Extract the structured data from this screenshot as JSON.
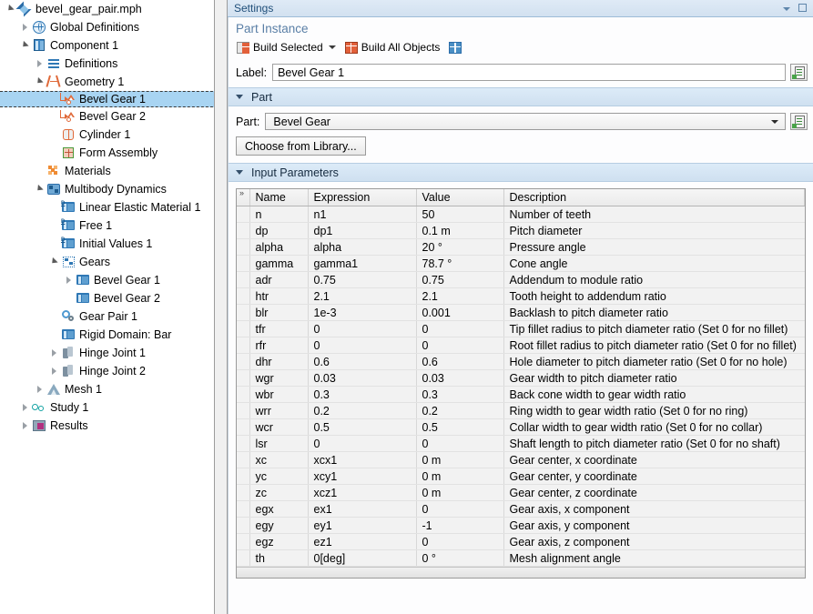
{
  "tree": {
    "items": [
      {
        "label": "bevel_gear_pair.mph",
        "indent": 0,
        "twisty": "open",
        "icon": "mph-file-icon",
        "selected": false
      },
      {
        "label": "Global Definitions",
        "indent": 1,
        "twisty": "closed",
        "icon": "globe-icon",
        "selected": false
      },
      {
        "label": "Component 1",
        "indent": 1,
        "twisty": "open",
        "icon": "component-icon",
        "selected": false
      },
      {
        "label": "Definitions",
        "indent": 2,
        "twisty": "closed",
        "icon": "definitions-icon",
        "selected": false
      },
      {
        "label": "Geometry 1",
        "indent": 2,
        "twisty": "open",
        "icon": "geometry-icon",
        "selected": false
      },
      {
        "label": "Bevel Gear 1",
        "indent": 3,
        "twisty": "none",
        "icon": "bevel-gear-geom-icon",
        "selected": true
      },
      {
        "label": "Bevel Gear 2",
        "indent": 3,
        "twisty": "none",
        "icon": "bevel-gear-geom-icon",
        "selected": false
      },
      {
        "label": "Cylinder 1",
        "indent": 3,
        "twisty": "none",
        "icon": "cylinder-icon",
        "selected": false
      },
      {
        "label": "Form Assembly",
        "indent": 3,
        "twisty": "none",
        "icon": "form-assembly-icon",
        "selected": false
      },
      {
        "label": "Materials",
        "indent": 2,
        "twisty": "none",
        "icon": "materials-icon",
        "selected": false
      },
      {
        "label": "Multibody Dynamics",
        "indent": 2,
        "twisty": "open",
        "icon": "multibody-dynamics-icon",
        "selected": false
      },
      {
        "label": "Linear Elastic Material 1",
        "indent": 3,
        "twisty": "none",
        "icon": "domain-icon",
        "selected": false
      },
      {
        "label": "Free 1",
        "indent": 3,
        "twisty": "none",
        "icon": "domain-icon",
        "selected": false
      },
      {
        "label": "Initial Values 1",
        "indent": 3,
        "twisty": "none",
        "icon": "domain-icon",
        "selected": false
      },
      {
        "label": "Gears",
        "indent": 3,
        "twisty": "open",
        "icon": "gears-icon",
        "selected": false
      },
      {
        "label": "Bevel Gear 1",
        "indent": 4,
        "twisty": "closed",
        "icon": "gear-node-icon",
        "selected": false
      },
      {
        "label": "Bevel Gear 2",
        "indent": 4,
        "twisty": "none",
        "icon": "gear-node-icon",
        "selected": false
      },
      {
        "label": "Gear Pair 1",
        "indent": 3,
        "twisty": "none",
        "icon": "gear-pair-icon",
        "selected": false
      },
      {
        "label": "Rigid Domain: Bar",
        "indent": 3,
        "twisty": "none",
        "icon": "gear-node-icon",
        "selected": false
      },
      {
        "label": "Hinge Joint 1",
        "indent": 3,
        "twisty": "closed",
        "icon": "hinge-joint-icon",
        "selected": false
      },
      {
        "label": "Hinge Joint 2",
        "indent": 3,
        "twisty": "closed",
        "icon": "hinge-joint-icon",
        "selected": false
      },
      {
        "label": "Mesh 1",
        "indent": 2,
        "twisty": "closed",
        "icon": "mesh-icon",
        "selected": false
      },
      {
        "label": "Study 1",
        "indent": 1,
        "twisty": "closed",
        "icon": "study-icon",
        "selected": false
      },
      {
        "label": "Results",
        "indent": 1,
        "twisty": "closed",
        "icon": "results-icon",
        "selected": false
      }
    ]
  },
  "settings": {
    "title": "Settings",
    "node_type": "Part Instance",
    "toolbar": {
      "build_selected": "Build Selected",
      "build_all_objects": "Build All Objects"
    },
    "label_field": {
      "label": "Label:",
      "value": "Bevel Gear 1"
    },
    "part_section": {
      "title": "Part",
      "part_label": "Part:",
      "part_value": "Bevel Gear",
      "choose_library_button": "Choose from Library..."
    },
    "input_parameters": {
      "title": "Input Parameters",
      "columns": [
        "Name",
        "Expression",
        "Value",
        "Description"
      ],
      "rows": [
        {
          "name": "n",
          "expression": "n1",
          "value": "50",
          "description": "Number of teeth"
        },
        {
          "name": "dp",
          "expression": "dp1",
          "value": "0.1 m",
          "description": "Pitch diameter"
        },
        {
          "name": "alpha",
          "expression": "alpha",
          "value": "20 °",
          "description": "Pressure angle"
        },
        {
          "name": "gamma",
          "expression": "gamma1",
          "value": "78.7 °",
          "description": "Cone angle"
        },
        {
          "name": "adr",
          "expression": "0.75",
          "value": "0.75",
          "description": "Addendum to module ratio"
        },
        {
          "name": "htr",
          "expression": "2.1",
          "value": "2.1",
          "description": "Tooth height to addendum ratio"
        },
        {
          "name": "blr",
          "expression": "1e-3",
          "value": "0.001",
          "description": "Backlash to pitch diameter ratio"
        },
        {
          "name": "tfr",
          "expression": "0",
          "value": "0",
          "description": "Tip fillet radius to pitch diameter ratio (Set 0 for no fillet)"
        },
        {
          "name": "rfr",
          "expression": "0",
          "value": "0",
          "description": "Root fillet radius to pitch diameter ratio (Set 0 for no fillet)"
        },
        {
          "name": "dhr",
          "expression": "0.6",
          "value": "0.6",
          "description": "Hole diameter to pitch diameter ratio (Set 0 for no hole)"
        },
        {
          "name": "wgr",
          "expression": "0.03",
          "value": "0.03",
          "description": "Gear width to pitch diameter ratio"
        },
        {
          "name": "wbr",
          "expression": "0.3",
          "value": "0.3",
          "description": "Back cone width to gear width ratio"
        },
        {
          "name": "wrr",
          "expression": "0.2",
          "value": "0.2",
          "description": "Ring width to gear width ratio (Set 0 for no ring)"
        },
        {
          "name": "wcr",
          "expression": "0.5",
          "value": "0.5",
          "description": "Collar width to gear width ratio (Set 0 for no collar)"
        },
        {
          "name": "lsr",
          "expression": "0",
          "value": "0",
          "description": "Shaft length to pitch diameter ratio (Set 0 for no shaft)"
        },
        {
          "name": "xc",
          "expression": "xcx1",
          "value": "0 m",
          "description": "Gear center, x coordinate"
        },
        {
          "name": "yc",
          "expression": "xcy1",
          "value": "0 m",
          "description": "Gear center, y coordinate"
        },
        {
          "name": "zc",
          "expression": "xcz1",
          "value": "0 m",
          "description": "Gear center, z coordinate"
        },
        {
          "name": "egx",
          "expression": "ex1",
          "value": "0",
          "description": "Gear axis, x component"
        },
        {
          "name": "egy",
          "expression": "ey1",
          "value": "-1",
          "description": "Gear axis, y component"
        },
        {
          "name": "egz",
          "expression": "ez1",
          "value": "0",
          "description": "Gear axis, z component"
        },
        {
          "name": "th",
          "expression": "0[deg]",
          "value": "0 °",
          "description": "Mesh alignment angle"
        }
      ]
    }
  },
  "colors": {
    "selection": "#a8d4f2",
    "section_header": "#d5e4f2",
    "title_text": "#1f4e79",
    "node_type_text": "#5a7fa6",
    "geometry_icon": "#e06a3a",
    "physics_icon": "#2f78b5"
  }
}
